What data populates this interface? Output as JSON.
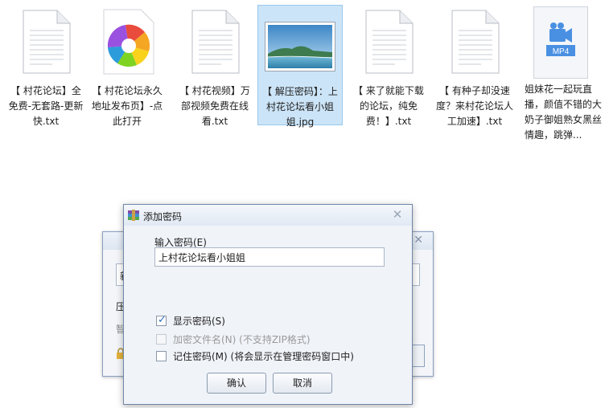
{
  "files": [
    {
      "name": "【 村花论坛】全免费-无套路-更新快.txt",
      "type": "txt"
    },
    {
      "name": "【 村花论坛永久地址发布页】-点此打开",
      "type": "app"
    },
    {
      "name": "【 村花视频】万部视频免费在线看.txt",
      "type": "txt"
    },
    {
      "name": "【 解压密码】：上村花论坛看小姐姐.jpg",
      "type": "jpg",
      "selected": true
    },
    {
      "name": "【 来了就能下载的论坛，纯免费！】.txt",
      "type": "txt"
    },
    {
      "name": "【 有种子却没速度？来村花论坛人工加速】.txt",
      "type": "txt"
    },
    {
      "name": "姐妹花一起玩直播，颜值不错的大奶子御姐熟女黑丝情趣，跳弹...",
      "type": "mp4",
      "badge": "MP4"
    }
  ],
  "back_dialog": {
    "fragments": [
      "新",
      "压",
      "智"
    ],
    "close_label": "✕"
  },
  "dialog": {
    "title": "添加密码",
    "close_label": "✕",
    "password_label": "输入密码(E)",
    "password_value": "上村花论坛看小姐姐",
    "options": [
      {
        "label": "显示密码(S)",
        "checked": true,
        "enabled": true
      },
      {
        "label": "加密文件名(N) (不支持ZIP格式)",
        "checked": false,
        "enabled": false
      },
      {
        "label": "记住密码(M) (将会显示在管理密码窗口中)",
        "checked": false,
        "enabled": true
      }
    ],
    "ok_label": "确认",
    "cancel_label": "取消"
  },
  "colors": {
    "selection": "#cce4f7",
    "accent": "#2f6fc0",
    "mp4_blue": "#4a90e2"
  }
}
